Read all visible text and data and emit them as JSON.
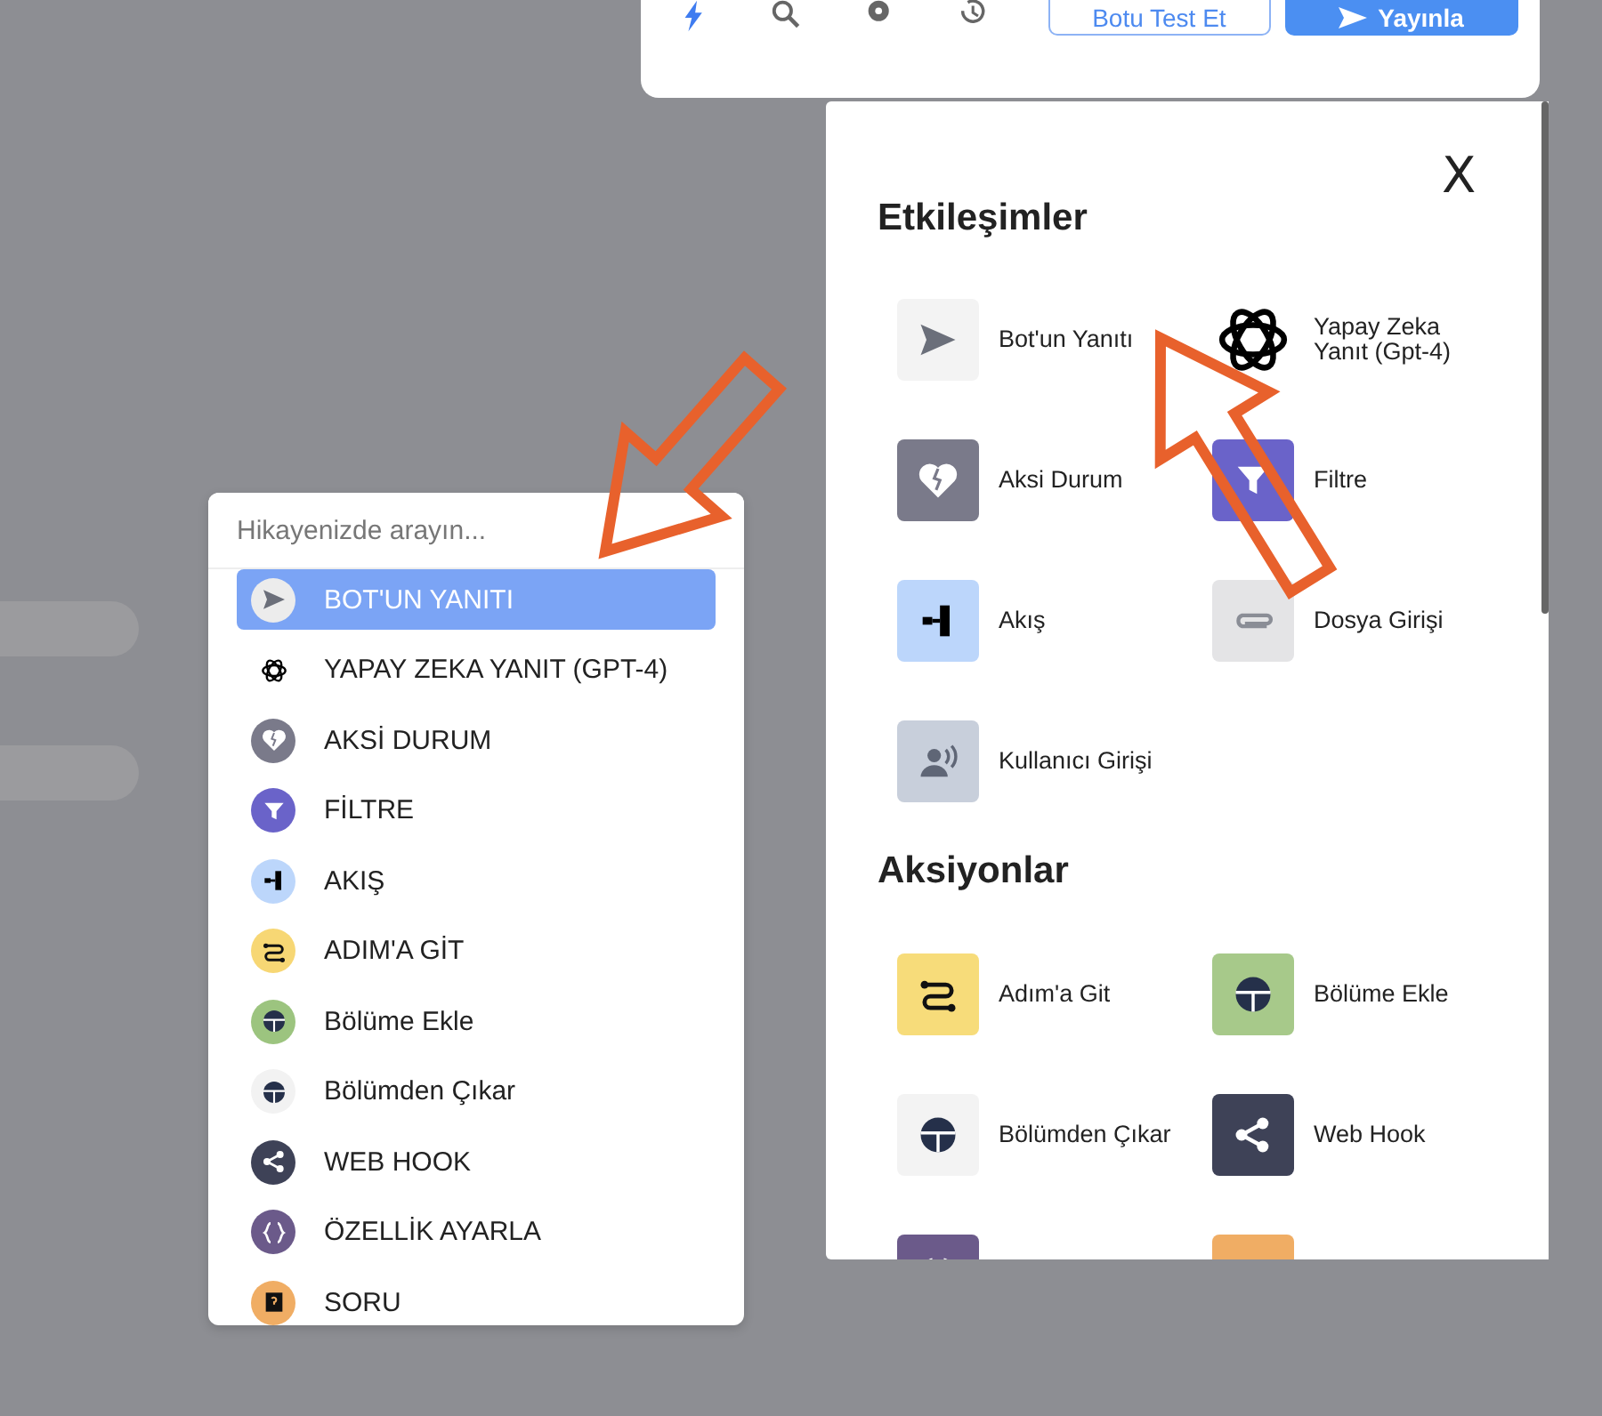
{
  "toolbar": {
    "buttons": [
      {
        "kind": "test",
        "label": "Botu Test Et"
      },
      {
        "kind": "publish",
        "label": "Yayınla"
      }
    ]
  },
  "search": {
    "placeholder": "Hikayenizde arayın..."
  },
  "menu_items": [
    {
      "kind": "reply",
      "label": "BOT'UN YANITI",
      "color": "#ececec",
      "selected": true
    },
    {
      "kind": "gpt",
      "label": "YAPAY ZEKA YANIT (GPT-4)",
      "color": "#ffffff",
      "selected": false
    },
    {
      "kind": "broken",
      "label": "AKSİ DURUM",
      "color": "#7a7a8a",
      "selected": false
    },
    {
      "kind": "filter",
      "label": "FİLTRE",
      "color": "#6a63c9",
      "selected": false
    },
    {
      "kind": "flow",
      "label": "AKIŞ",
      "color": "#bcd6fb",
      "selected": false
    },
    {
      "kind": "goto",
      "label": "ADIM'A GİT",
      "color": "#f7d774",
      "selected": false
    },
    {
      "kind": "section",
      "label": "Bölüme Ekle",
      "color": "#9cc47f",
      "selected": false
    },
    {
      "kind": "section",
      "label": "Bölümden Çıkar",
      "color": "#f2f2f2",
      "selected": false
    },
    {
      "kind": "share",
      "label": "WEB HOOK",
      "color": "#3e4257",
      "selected": false
    },
    {
      "kind": "braces",
      "label": "ÖZELLİK AYARLA",
      "color": "#6b5a8a",
      "selected": false
    },
    {
      "kind": "question",
      "label": "SORU",
      "color": "#f0ad64",
      "selected": false
    }
  ],
  "panel": {
    "close": "X",
    "sections": [
      {
        "title": "Etkileşimler",
        "items": [
          {
            "kind": "reply",
            "label": "Bot'un Yanıtı",
            "color": "#f3f3f3"
          },
          {
            "kind": "gpt",
            "label": "Yapay Zeka Yanıt (Gpt-4)",
            "color": "#ffffff"
          },
          {
            "kind": "broken",
            "label": "Aksi Durum",
            "color": "#7a7a8a"
          },
          {
            "kind": "filter",
            "label": "Filtre",
            "color": "#6a63c9"
          },
          {
            "kind": "flow",
            "label": "Akış",
            "color": "#bcd6fb"
          },
          {
            "kind": "clip",
            "label": "Dosya Girişi",
            "color": "#e4e4e6"
          },
          {
            "kind": "voice",
            "label": "Kullanıcı Girişi",
            "color": "#c8cfdb"
          }
        ]
      },
      {
        "title": "Aksiyonlar",
        "items": [
          {
            "kind": "goto",
            "label": "Adım'a Git",
            "color": "#f7dc7a"
          },
          {
            "kind": "section",
            "label": "Bölüme Ekle",
            "color": "#a7c98a"
          },
          {
            "kind": "section",
            "label": "Bölümden Çıkar",
            "color": "#f3f3f3"
          },
          {
            "kind": "share",
            "label": "Web Hook",
            "color": "#3e4257"
          },
          {
            "kind": "braces",
            "color": "#6b5a8a"
          },
          {
            "kind": "question",
            "color": "#f0ad64"
          }
        ]
      }
    ]
  }
}
